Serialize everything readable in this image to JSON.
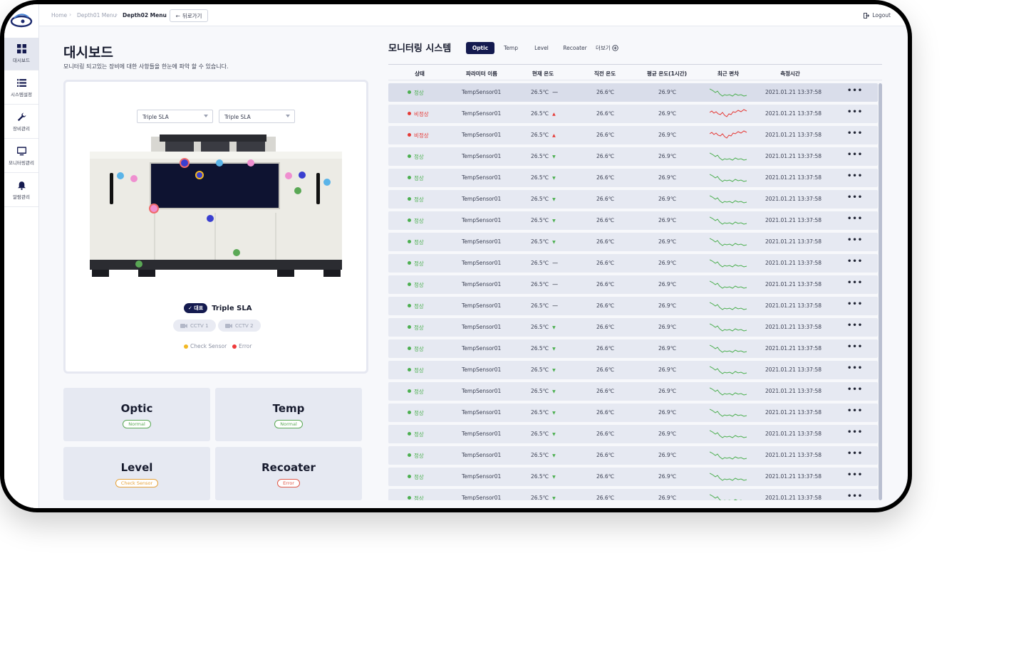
{
  "sidebar": {
    "items": [
      {
        "label": "대시보드",
        "icon": "dashboard-icon",
        "active": true
      },
      {
        "label": "시스템설정",
        "icon": "list-icon",
        "active": false
      },
      {
        "label": "장비관리",
        "icon": "wrench-icon",
        "active": false
      },
      {
        "label": "모니터링관리",
        "icon": "monitor-icon",
        "active": false
      },
      {
        "label": "알람관리",
        "icon": "bell-icon",
        "active": false
      }
    ]
  },
  "header": {
    "breadcrumb": [
      "Home",
      "Depth01 Menu",
      "Depth02 Menu"
    ],
    "back_label": "뒤로가기",
    "logout_label": "Logout"
  },
  "dashboard": {
    "title": "대시보드",
    "subtitle": "모니터링 되고있는 장비에 대한 사항들을 한눈에 파악 할 수 있습니다.",
    "select1": "Triple SLA",
    "select2": "Triple SLA",
    "rep_badge": "✓ 대표",
    "rep_name": "Triple SLA",
    "cctv1": "CCTV 1",
    "cctv2": "CCTV 2",
    "legend_check": "Check Sensor",
    "legend_error": "Error",
    "legend_check_color": "#f2b824",
    "legend_error_color": "#ef3a3a"
  },
  "stats": [
    {
      "title": "Optic",
      "badge": "Normal",
      "color": "#5aa855"
    },
    {
      "title": "Temp",
      "badge": "Normal",
      "color": "#5aa855"
    },
    {
      "title": "Level",
      "badge": "Check Sensor",
      "color": "#e6a23a"
    },
    {
      "title": "Recoater",
      "badge": "Error",
      "color": "#e05a4a"
    }
  ],
  "monitor": {
    "title": "모니터링 시스템",
    "tabs": [
      "Optic",
      "Temp",
      "Level",
      "Recoater"
    ],
    "more_label": "더보기",
    "columns": [
      "상태",
      "파라미터 이름",
      "현재 온도",
      "직전 온도",
      "평균 온도(1시간)",
      "최근 편차",
      "측정시간"
    ],
    "rows": [
      {
        "status": "정상",
        "ok": true,
        "name": "TempSensor01",
        "current": "26.5℃",
        "trend": "flat",
        "prev": "26.6℃",
        "avg": "26.9℃",
        "time": "2021.01.21 13:37:58"
      },
      {
        "status": "비정상",
        "ok": false,
        "name": "TempSensor01",
        "current": "26.5℃",
        "trend": "up",
        "prev": "26.6℃",
        "avg": "26.9℃",
        "time": "2021.01.21 13:37:58"
      },
      {
        "status": "비정상",
        "ok": false,
        "name": "TempSensor01",
        "current": "26.5℃",
        "trend": "up",
        "prev": "26.6℃",
        "avg": "26.9℃",
        "time": "2021.01.21 13:37:58"
      },
      {
        "status": "정상",
        "ok": true,
        "name": "TempSensor01",
        "current": "26.5℃",
        "trend": "down",
        "prev": "26.6℃",
        "avg": "26.9℃",
        "time": "2021.01.21 13:37:58"
      },
      {
        "status": "정상",
        "ok": true,
        "name": "TempSensor01",
        "current": "26.5℃",
        "trend": "down",
        "prev": "26.6℃",
        "avg": "26.9℃",
        "time": "2021.01.21 13:37:58"
      },
      {
        "status": "정상",
        "ok": true,
        "name": "TempSensor01",
        "current": "26.5℃",
        "trend": "down",
        "prev": "26.6℃",
        "avg": "26.9℃",
        "time": "2021.01.21 13:37:58"
      },
      {
        "status": "정상",
        "ok": true,
        "name": "TempSensor01",
        "current": "26.5℃",
        "trend": "down",
        "prev": "26.6℃",
        "avg": "26.9℃",
        "time": "2021.01.21 13:37:58"
      },
      {
        "status": "정상",
        "ok": true,
        "name": "TempSensor01",
        "current": "26.5℃",
        "trend": "down",
        "prev": "26.6℃",
        "avg": "26.9℃",
        "time": "2021.01.21 13:37:58"
      },
      {
        "status": "정상",
        "ok": true,
        "name": "TempSensor01",
        "current": "26.5℃",
        "trend": "flat",
        "prev": "26.6℃",
        "avg": "26.9℃",
        "time": "2021.01.21 13:37:58"
      },
      {
        "status": "정상",
        "ok": true,
        "name": "TempSensor01",
        "current": "26.5℃",
        "trend": "flat",
        "prev": "26.6℃",
        "avg": "26.9℃",
        "time": "2021.01.21 13:37:58"
      },
      {
        "status": "정상",
        "ok": true,
        "name": "TempSensor01",
        "current": "26.5℃",
        "trend": "flat",
        "prev": "26.6℃",
        "avg": "26.9℃",
        "time": "2021.01.21 13:37:58"
      },
      {
        "status": "정상",
        "ok": true,
        "name": "TempSensor01",
        "current": "26.5℃",
        "trend": "down",
        "prev": "26.6℃",
        "avg": "26.9℃",
        "time": "2021.01.21 13:37:58"
      },
      {
        "status": "정상",
        "ok": true,
        "name": "TempSensor01",
        "current": "26.5℃",
        "trend": "down",
        "prev": "26.6℃",
        "avg": "26.9℃",
        "time": "2021.01.21 13:37:58"
      },
      {
        "status": "정상",
        "ok": true,
        "name": "TempSensor01",
        "current": "26.5℃",
        "trend": "down",
        "prev": "26.6℃",
        "avg": "26.9℃",
        "time": "2021.01.21 13:37:58"
      },
      {
        "status": "정상",
        "ok": true,
        "name": "TempSensor01",
        "current": "26.5℃",
        "trend": "down",
        "prev": "26.6℃",
        "avg": "26.9℃",
        "time": "2021.01.21 13:37:58"
      },
      {
        "status": "정상",
        "ok": true,
        "name": "TempSensor01",
        "current": "26.5℃",
        "trend": "down",
        "prev": "26.6℃",
        "avg": "26.9℃",
        "time": "2021.01.21 13:37:58"
      },
      {
        "status": "정상",
        "ok": true,
        "name": "TempSensor01",
        "current": "26.5℃",
        "trend": "down",
        "prev": "26.6℃",
        "avg": "26.9℃",
        "time": "2021.01.21 13:37:58"
      },
      {
        "status": "정상",
        "ok": true,
        "name": "TempSensor01",
        "current": "26.5℃",
        "trend": "down",
        "prev": "26.6℃",
        "avg": "26.9℃",
        "time": "2021.01.21 13:37:58"
      },
      {
        "status": "정상",
        "ok": true,
        "name": "TempSensor01",
        "current": "26.5℃",
        "trend": "down",
        "prev": "26.6℃",
        "avg": "26.9℃",
        "time": "2021.01.21 13:37:58"
      },
      {
        "status": "정상",
        "ok": true,
        "name": "TempSensor01",
        "current": "26.5℃",
        "trend": "down",
        "prev": "26.6℃",
        "avg": "26.9℃",
        "time": "2021.01.21 13:37:58"
      }
    ],
    "ok_color": "#4caf50",
    "bad_color": "#e53935"
  }
}
